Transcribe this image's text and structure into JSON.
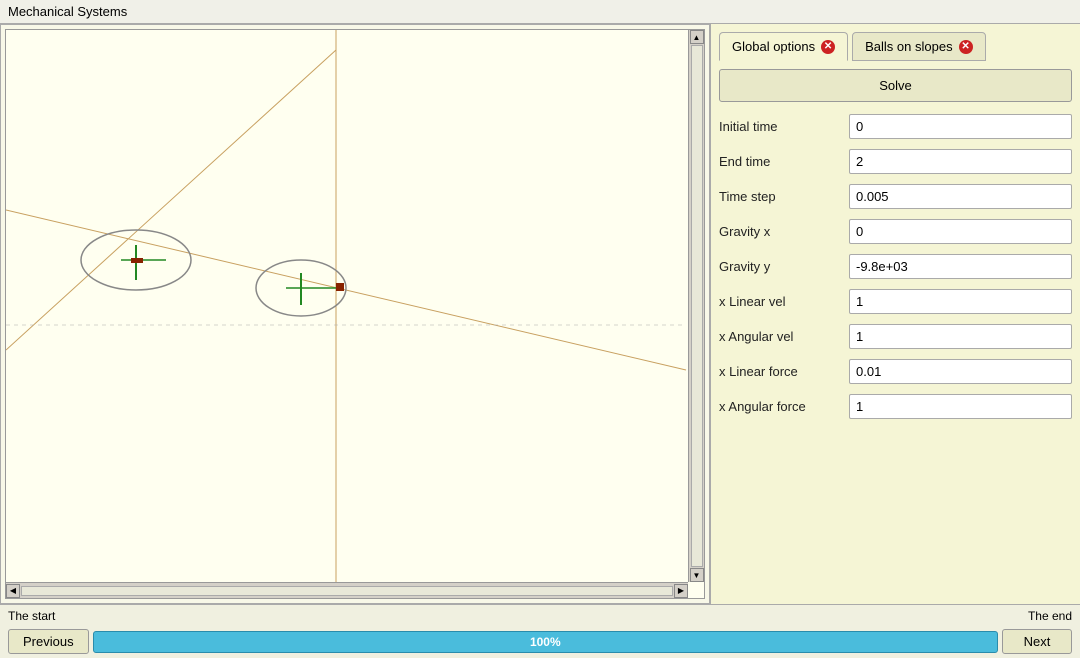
{
  "title": "Mechanical Systems",
  "tabs": [
    {
      "label": "Global options",
      "active": true
    },
    {
      "label": "Balls on slopes",
      "active": false
    }
  ],
  "panel": {
    "solve_button": "Solve",
    "fields": [
      {
        "label": "Initial time",
        "value": "0"
      },
      {
        "label": "End time",
        "value": "2"
      },
      {
        "label": "Time step",
        "value": "0.005"
      },
      {
        "label": "Gravity x",
        "value": "0"
      },
      {
        "label": "Gravity y",
        "value": "-9.8e+03"
      },
      {
        "label": "x Linear vel",
        "value": "1"
      },
      {
        "label": "x Angular vel",
        "value": "1"
      },
      {
        "label": "x Linear force",
        "value": "0.01"
      },
      {
        "label": "x Angular force",
        "value": "1"
      }
    ]
  },
  "bottom": {
    "start_label": "The start",
    "end_label": "The end",
    "previous_label": "Previous",
    "next_label": "Next",
    "progress_label": "100%"
  }
}
